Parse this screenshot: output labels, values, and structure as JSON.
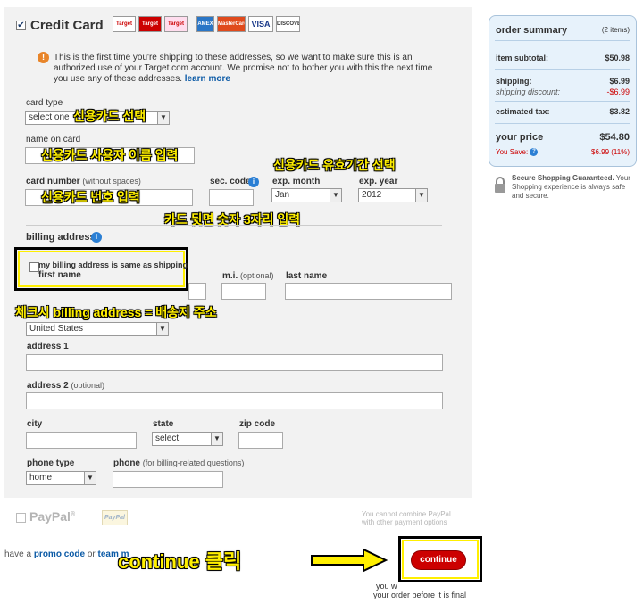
{
  "credit_card": {
    "title": "Credit Card",
    "notice": "This is the first time you're shipping to these addresses, so we want to make sure this is an authorized use of your Target.com account. We promise not to bother you with this the next time you use any of these addresses.",
    "learn_more": "learn more",
    "card_logos": [
      "Target",
      "Target",
      "Target",
      "AMEX",
      "MasterCard",
      "VISA",
      "DISCOVER"
    ]
  },
  "form": {
    "card_type_label": "card type",
    "card_type_value": "select one",
    "name_label": "name on card",
    "card_number_label": "card number",
    "card_number_hint": "(without spaces)",
    "sec_code_label": "sec. code",
    "exp_month_label": "exp. month",
    "exp_month_value": "Jan",
    "exp_year_label": "exp. year",
    "exp_year_value": "2012",
    "billing_label": "billing address.",
    "same_as_shipping": "my billing address is same as shipping",
    "first_name_label": "first name",
    "mi_label": "m.i.",
    "mi_hint": "(optional)",
    "last_name_label": "last name",
    "country_value": "United States",
    "address1_label": "address 1",
    "address2_label": "address 2",
    "address2_hint": "(optional)",
    "city_label": "city",
    "state_label": "state",
    "state_value": "select",
    "zip_label": "zip code",
    "phone_type_label": "phone type",
    "phone_type_value": "home",
    "phone_label": "phone",
    "phone_hint": "(for billing-related questions)"
  },
  "paypal": {
    "label": "PayPal",
    "reg": "®",
    "logo": "PayPal",
    "note": "You cannot combine PayPal with other payment options"
  },
  "promo": {
    "prefix": "have a",
    "promo_link": "promo code",
    "or": "or",
    "team_link": "team m"
  },
  "continue": {
    "button": "continue",
    "note1": "you w",
    "note2": "your order before it is final"
  },
  "summary": {
    "title": "order summary",
    "items": "(2 items)",
    "subtotal_label": "item subtotal:",
    "subtotal": "$50.98",
    "shipping_label": "shipping:",
    "shipping": "$6.99",
    "discount_label": "shipping discount:",
    "discount": "-$6.99",
    "tax_label": "estimated tax:",
    "tax": "$3.82",
    "price_label": "your price",
    "price": "$54.80",
    "save_label": "You Save:",
    "save": "$6.99 (11%)"
  },
  "secure": {
    "title": "Secure Shopping Guaranteed.",
    "text": "Your Shopping experience is always safe and secure."
  },
  "annotations": {
    "card_type": "신용카드 선택",
    "name": "신용카드 사용자 이름 입력",
    "expiry": "신용카드 유효기간 선택",
    "number": "신용카드 번호 입력",
    "sec_code": "카드 뒷면 숫자 3자리 입력",
    "checkbox": "체크시 billing address = 배송지 주소",
    "continue": "continue 클릭"
  },
  "colors": {
    "accent": "#cc0000",
    "link": "#0b5aa6",
    "highlight": "#ffef00"
  }
}
